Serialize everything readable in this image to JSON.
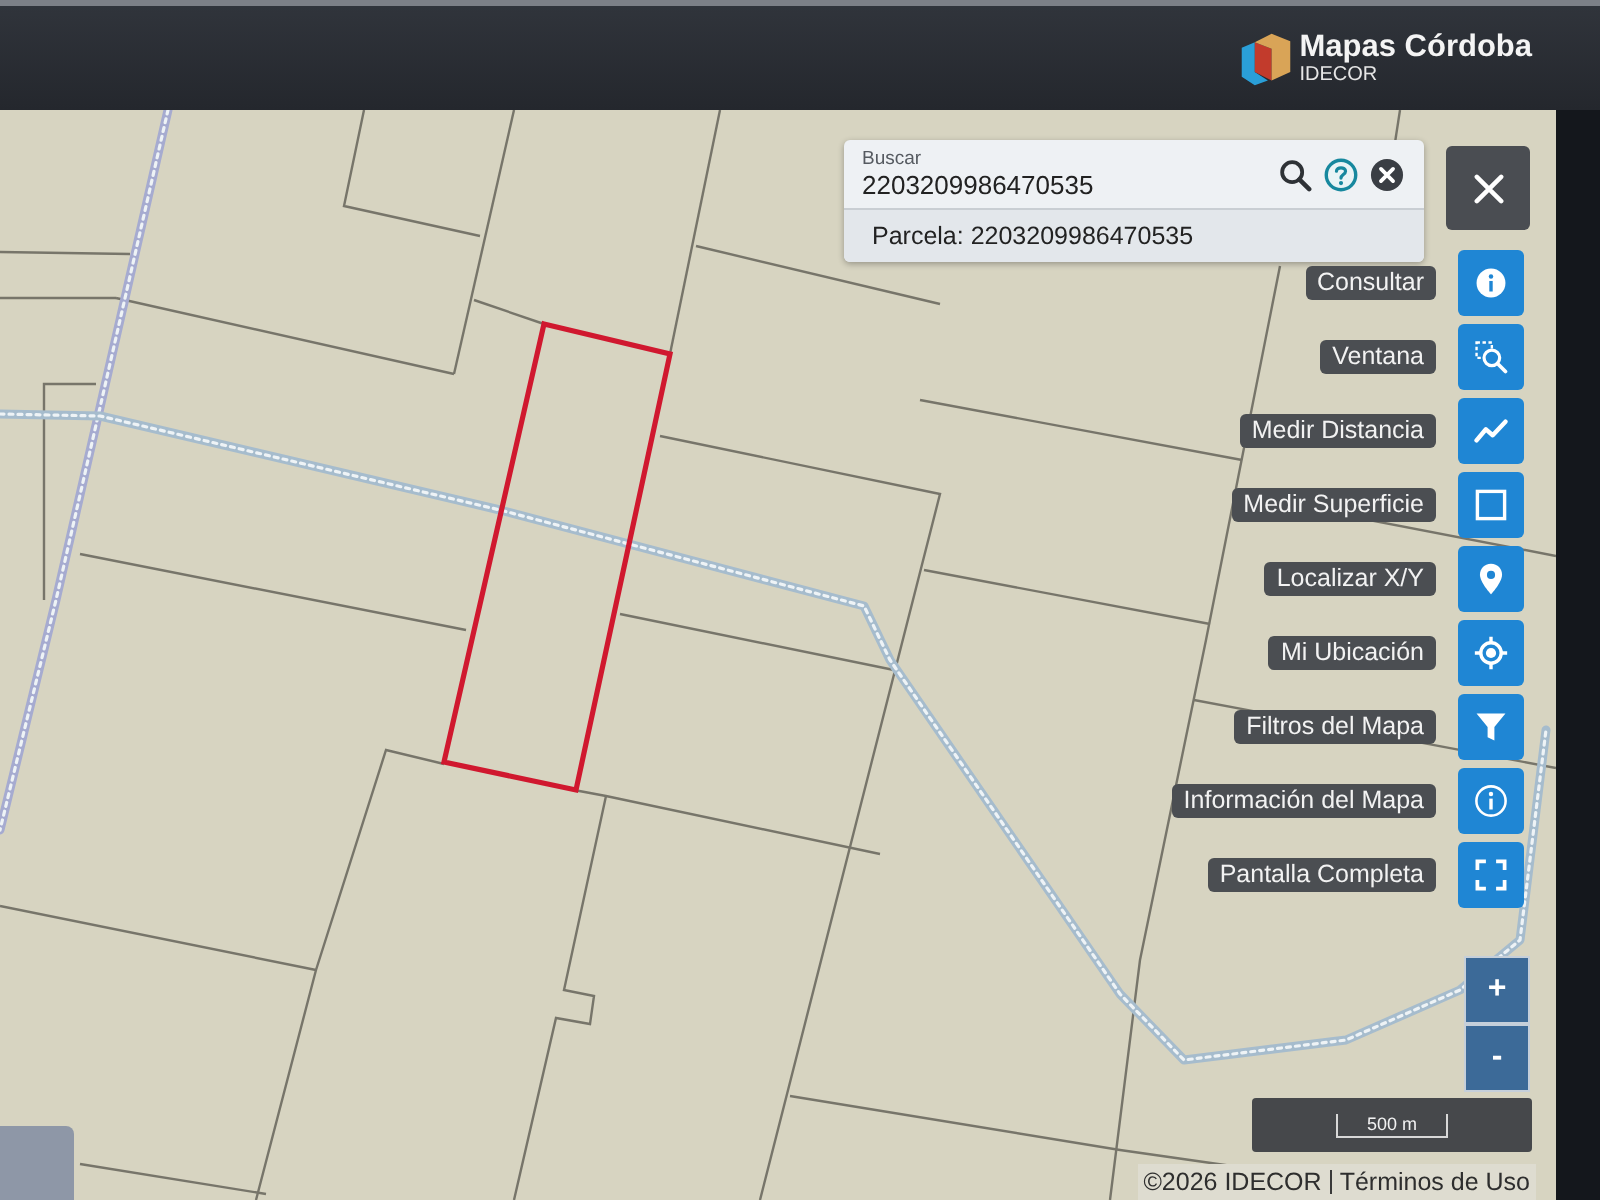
{
  "header": {
    "logo": {
      "title": "Mapas Córdoba",
      "subtitle": "IDECOR"
    }
  },
  "search": {
    "label": "Buscar",
    "value": "2203209986470535",
    "results": [
      {
        "text": "Parcela: 2203209986470535"
      }
    ]
  },
  "tools": [
    {
      "kind": "query",
      "label": "Consultar"
    },
    {
      "kind": "window-zoom",
      "label": "Ventana"
    },
    {
      "kind": "distance",
      "label": "Medir Distancia"
    },
    {
      "kind": "area",
      "label": "Medir Superficie"
    },
    {
      "kind": "locate-xy",
      "label": "Localizar X/Y"
    },
    {
      "kind": "my-location",
      "label": "Mi Ubicación"
    },
    {
      "kind": "filter",
      "label": "Filtros del Mapa"
    },
    {
      "kind": "map-info",
      "label": "Información del Mapa"
    },
    {
      "kind": "fullscreen",
      "label": "Pantalla Completa"
    }
  ],
  "zoom": {
    "in": "+",
    "out": "-"
  },
  "scale": {
    "label": "500 m"
  },
  "footer": {
    "copyright": "©2026 IDECOR",
    "terms_link": "Términos de Uso"
  }
}
